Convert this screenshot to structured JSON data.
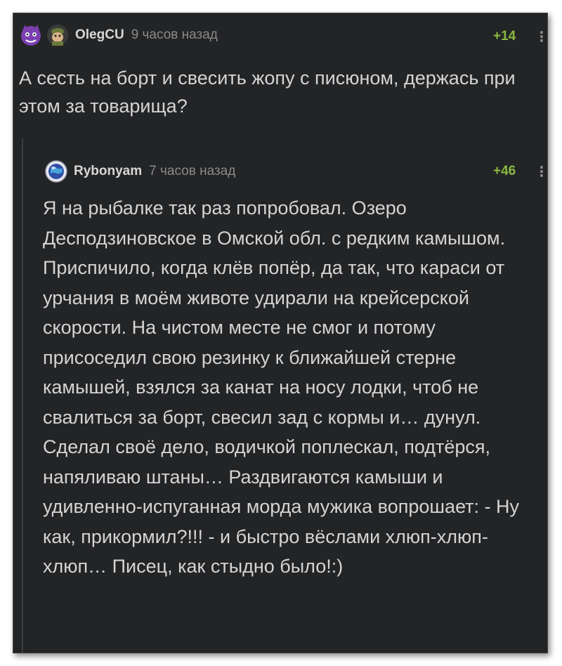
{
  "comment1": {
    "author": "OlegCU",
    "time": "9 часов назад",
    "rating": "+14",
    "more": "⋮",
    "text": "А сесть на борт и свесить жопу с писюном, держась при этом за товарища?"
  },
  "comment2": {
    "author": "Rybonyam",
    "time": "7 часов назад",
    "rating": "+46",
    "more": "⋮",
    "text": "Я на рыбалке так раз попробовал. Озеро Десподзиновское в Омской обл. с редким камышом. Приспичило, когда клёв попёр, да так, что караси от урчания в моём животе удирали на крейсерской скорости. На чистом месте не смог и потому присоседил свою резинку к ближайшей стерне камышей, взялся за канат на носу лодки, чтоб не свалиться за борт, свесил зад с кормы и… дунул. Сделал своё дело, водичкой поплескал, подтёрся, напяливаю штаны… Раздвигаются камыши и удивленно-испуганная морда мужика вопрошает: - Ну как, прикормил?!!! - и быстро вёслами хлюп-хлюп-хлюп… Писец, как стыдно было!:)"
  },
  "colors": {
    "background": "#232426",
    "rating": "#8ab842",
    "text": "#d4d4d4",
    "muted": "#8a8a8a"
  },
  "icons": [
    "purple-creature-avatar-icon",
    "cartoon-character-avatar-icon",
    "globe-avatar-icon"
  ]
}
